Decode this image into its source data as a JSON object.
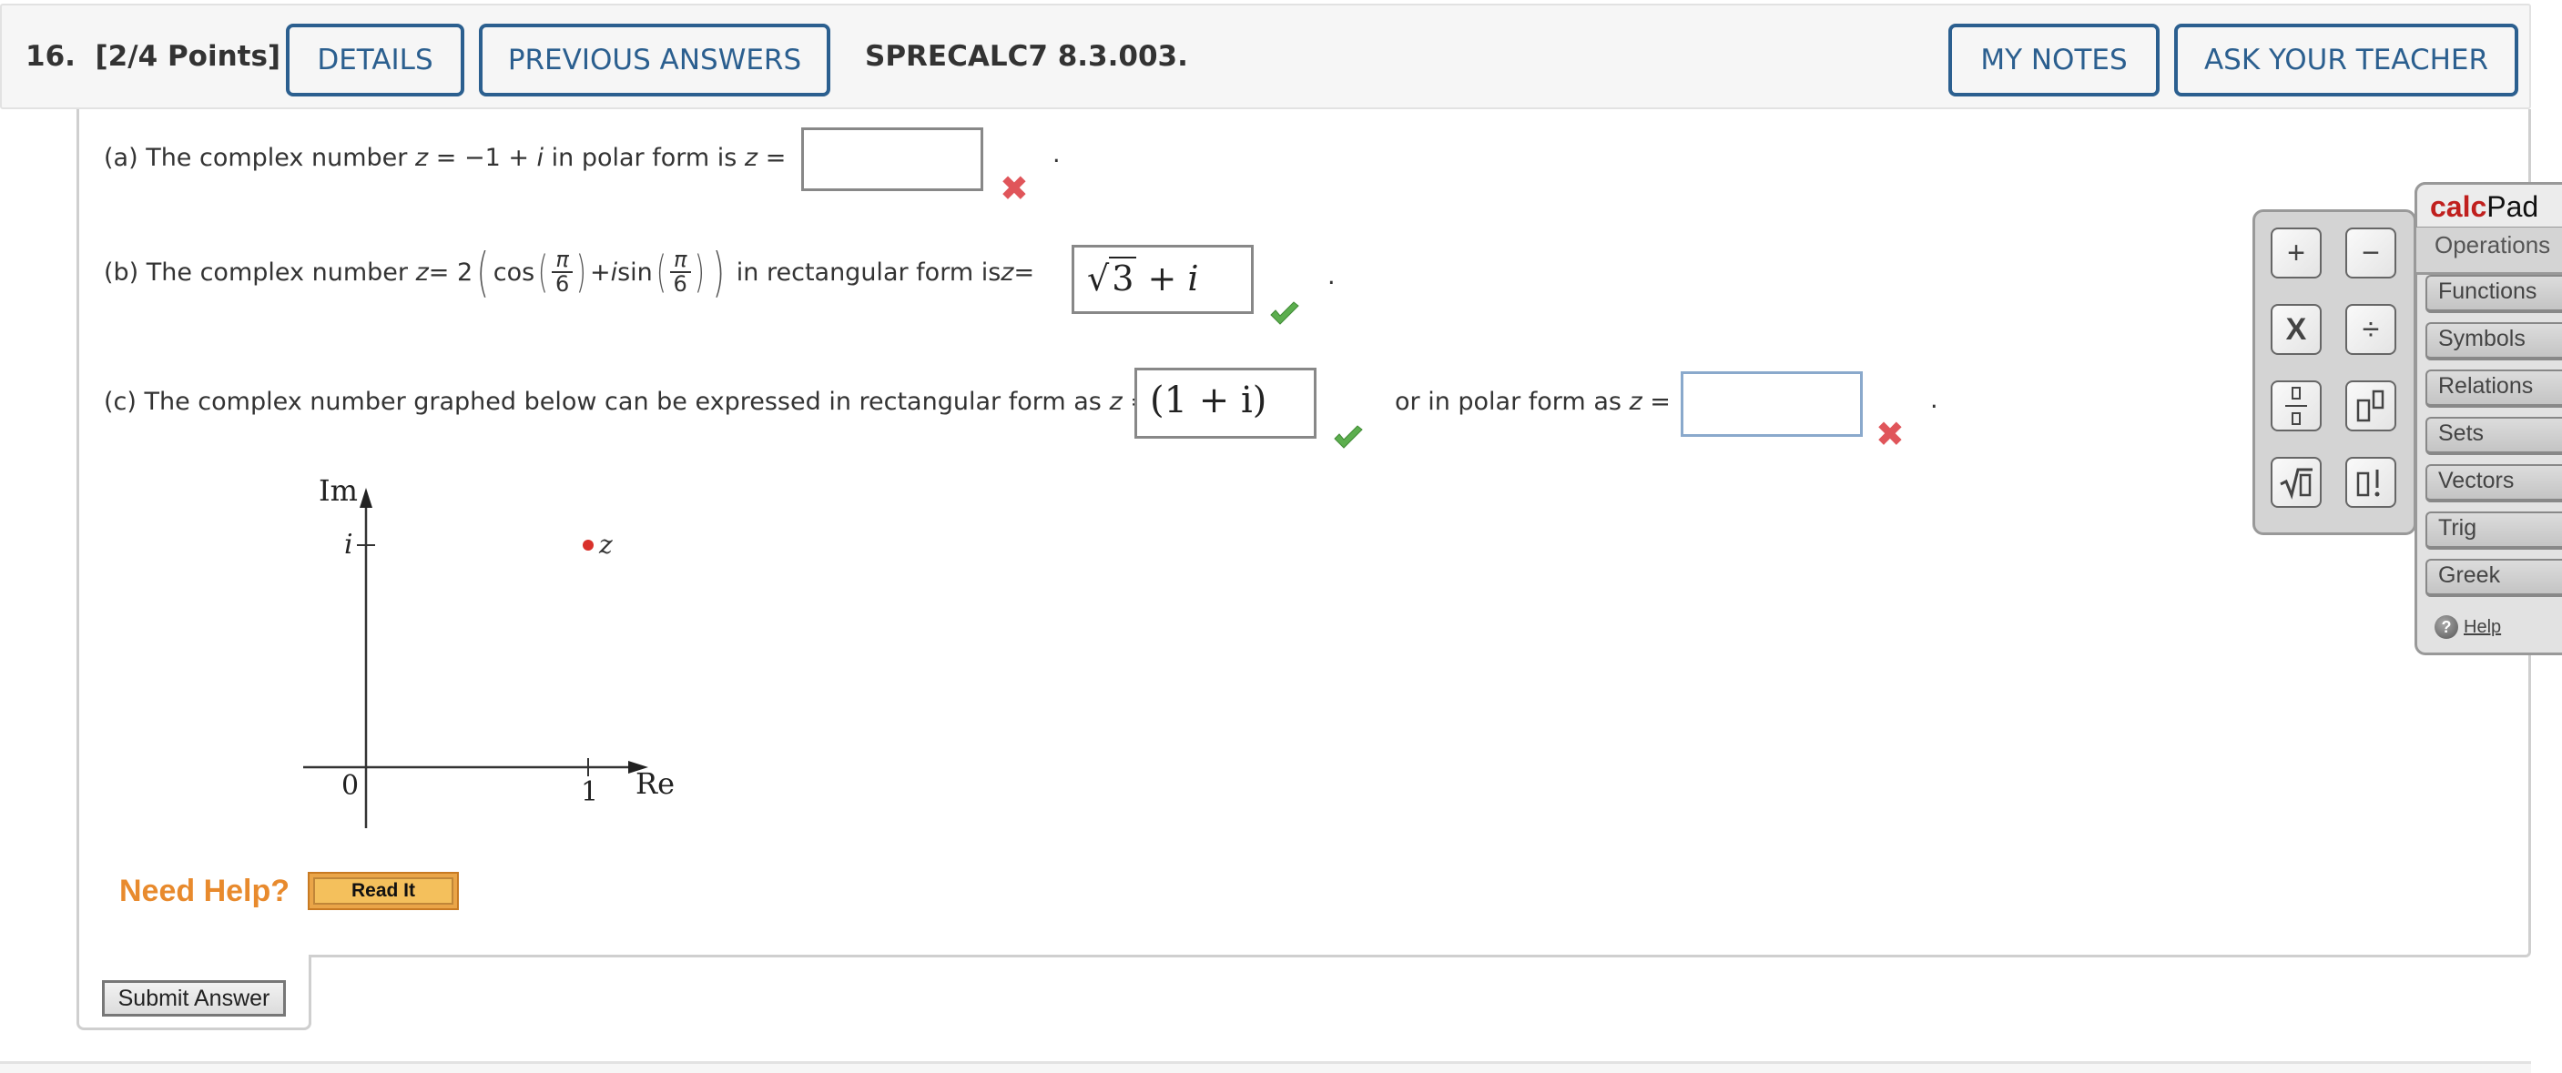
{
  "header": {
    "question_number": "16.",
    "points": "[2/4 Points]",
    "details_label": "DETAILS",
    "previous_answers_label": "PREVIOUS ANSWERS",
    "problem_code": "SPRECALC7 8.3.003.",
    "my_notes_label": "MY NOTES",
    "ask_teacher_label": "ASK YOUR TEACHER"
  },
  "parts": {
    "a": {
      "prefix": "(a) The complex number ",
      "z": "z",
      "expr": " = −1 + ",
      "i": "i",
      "mid": " in polar form is ",
      "z2": "z",
      "eq": " =",
      "answer": "",
      "status": "incorrect",
      "period": "."
    },
    "b": {
      "prefix": "(b) The complex number ",
      "z": "z",
      "eq_two": " = 2",
      "cos": "cos",
      "pi": "π",
      "six": "6",
      "plus_i": " + ",
      "i": "i",
      "sin": " sin",
      "mid": " in rectangular form is ",
      "z2": "z",
      "eq": " =",
      "answer_sqrt": "3",
      "answer_rest": " + i",
      "status": "correct",
      "period": "."
    },
    "c": {
      "prefix": "(c) The complex number graphed below can be expressed in rectangular form as ",
      "z": "z",
      "eq": " =",
      "answer_rect": "(1 + i)",
      "status_rect": "correct",
      "mid": "or in polar form as ",
      "z2": "z",
      "eq2": " =",
      "answer_polar": "",
      "status_polar": "incorrect",
      "period": "."
    }
  },
  "graph": {
    "y_axis_label": "Im",
    "x_axis_label": "Re",
    "origin_label": "0",
    "x_tick_label": "1",
    "y_tick_label": "i",
    "point_label": "z",
    "point": {
      "re": 1,
      "im": 1
    },
    "point_color": "#d9312b"
  },
  "help": {
    "need_help": "Need Help?",
    "read_it": "Read It"
  },
  "submit_label": "Submit Answer",
  "calcpad": {
    "title_calc": "calc",
    "title_pad": "Pad",
    "active_tab": "Operations",
    "keys": [
      "+",
      "−",
      "X",
      "÷",
      "fraction",
      "exponent",
      "sqrt",
      "factorial"
    ],
    "tabs": [
      "Functions",
      "Symbols",
      "Relations",
      "Sets",
      "Vectors",
      "Trig",
      "Greek"
    ],
    "help_label": "Help"
  }
}
